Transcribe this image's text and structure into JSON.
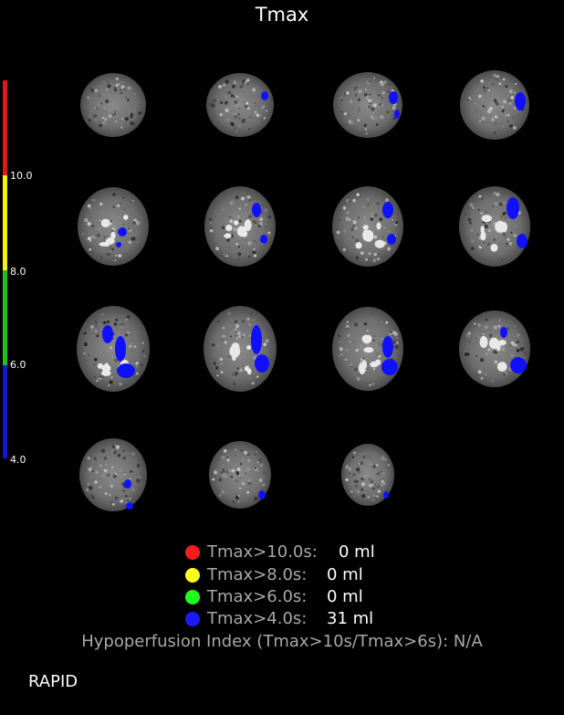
{
  "title": "Tmax",
  "scale": {
    "colors": {
      "red": "#e8141a",
      "yellow": "#f5ef12",
      "green": "#19c41d",
      "blue": "#1515d8"
    },
    "ticks": [
      "10.0",
      "8.0",
      "6.0",
      "4.0"
    ]
  },
  "legend": [
    {
      "color": "#ff0000",
      "label": "Tmax>10.0s:",
      "value": "0 ml"
    },
    {
      "color": "#ffff00",
      "label": "Tmax>8.0s:",
      "value": "0 ml"
    },
    {
      "color": "#00ff00",
      "label": "Tmax>6.0s:",
      "value": "0 ml"
    },
    {
      "color": "#0000ff",
      "label": "Tmax>4.0s:",
      "value": "31 ml"
    }
  ],
  "hypoperfusion": {
    "label": "Hypoperfusion Index (Tmax>10s/Tmax>6s):",
    "value": "N/A"
  },
  "brand": "RAPID"
}
